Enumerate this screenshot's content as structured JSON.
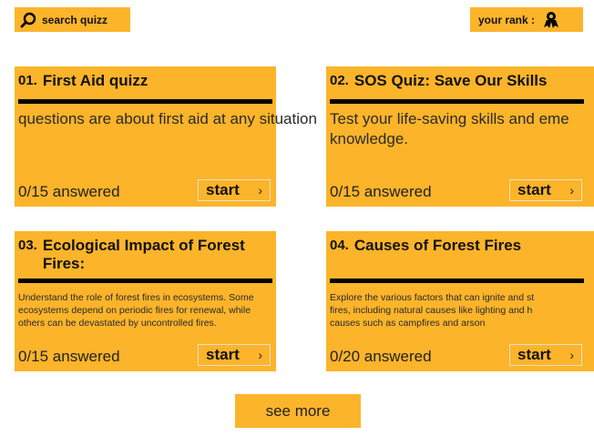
{
  "header": {
    "search_label": "search quizz",
    "rank_label": "your rank :"
  },
  "colors": {
    "accent": "#fcb42a",
    "rule": "#000000"
  },
  "icons": {
    "search": "search-icon",
    "rank": "rank-badge-icon"
  },
  "quizzes": [
    {
      "number": "01.",
      "title": "First Aid quizz",
      "description": "questions are about first aid at any situation",
      "answered": "0/15 answered",
      "start_label": "start"
    },
    {
      "number": "02.",
      "title": "SOS Quiz: Save Our Skills",
      "description_line1": "Test your life-saving skills and eme",
      "description_line2": "knowledge.",
      "answered": "0/15 answered",
      "start_label": "start"
    },
    {
      "number": "03.",
      "title_line1": "Ecological Impact of Forest",
      "title_line2": "Fires:",
      "description_line1": "Understand the role of forest fires in ecosystems. Some",
      "description_line2": "ecosystems depend on periodic fires for renewal, while",
      "description_line3": "others can be devastated by uncontrolled fires.",
      "answered": "0/15 answered",
      "start_label": "start"
    },
    {
      "number": "04.",
      "title": "Causes of Forest Fires",
      "description_line1": "Explore the various factors that can ignite and st",
      "description_line2": "fires, including natural causes like lighting and h",
      "description_line3": "causes such  as campfires and arson",
      "answered": "0/20 answered",
      "start_label": "start"
    }
  ],
  "footer": {
    "see_more_label": "see more"
  }
}
